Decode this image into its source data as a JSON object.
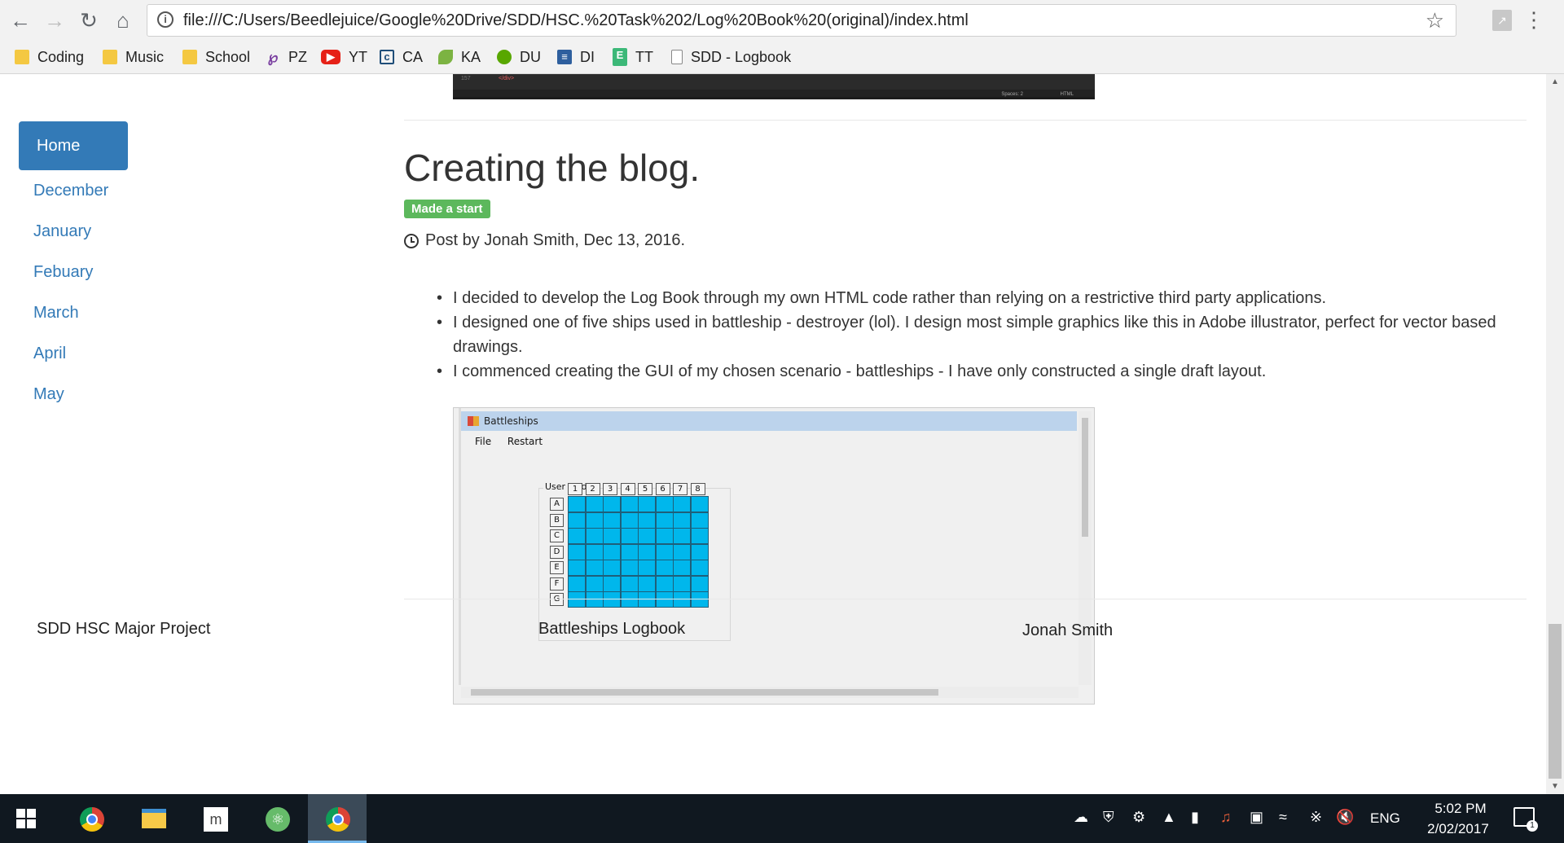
{
  "browser": {
    "url": "file:///C:/Users/Beedlejuice/Google%20Drive/SDD/HSC.%20Task%202/Log%20Book%20(original)/index.html",
    "bookmarks": [
      {
        "label": "Coding",
        "icon": "folder-icon"
      },
      {
        "label": "Music",
        "icon": "folder-icon"
      },
      {
        "label": "School",
        "icon": "folder-icon"
      },
      {
        "label": "PZ",
        "icon": "pz-icon"
      },
      {
        "label": "YT",
        "icon": "youtube-icon"
      },
      {
        "label": "CA",
        "icon": "ca-icon"
      },
      {
        "label": "KA",
        "icon": "khan-academy-icon"
      },
      {
        "label": "DU",
        "icon": "duolingo-icon"
      },
      {
        "label": "DI",
        "icon": "di-icon"
      },
      {
        "label": "TT",
        "icon": "tt-icon"
      },
      {
        "label": "SDD - Logbook",
        "icon": "page-icon"
      }
    ]
  },
  "sidebar": {
    "home": "Home",
    "items": [
      "December",
      "January",
      "Febuary",
      "March",
      "April",
      "May"
    ]
  },
  "post": {
    "title": "Creating the blog.",
    "badge": "Made a start",
    "meta": "Post by Jonah Smith, Dec 13, 2016.",
    "bullets": [
      "I decided to develop the Log Book through my own HTML code rather than relying on a restrictive third party applications.",
      "I designed one of five ships used in battleship - destroyer (lol). I design most simple graphics like this in Adobe illustrator, perfect for vector based drawings.",
      "I commenced creating the GUI of my chosen scenario - battleships - I have only constructed a single draft layout."
    ]
  },
  "prev_screenshot": {
    "line": "157",
    "tag": "</div>",
    "status_spaces": "Spaces: 2",
    "status_mode": "HTML"
  },
  "app_screenshot": {
    "title": "Battleships",
    "menu": [
      "File",
      "Restart"
    ],
    "group_label": "User Grid",
    "columns": [
      "1",
      "2",
      "3",
      "4",
      "5",
      "6",
      "7",
      "8"
    ],
    "rows": [
      "A",
      "B",
      "C",
      "D",
      "E",
      "F",
      "G"
    ],
    "cell_color": "#00b7ec"
  },
  "footer": {
    "left": "SDD HSC Major Project",
    "center": "Battleships Logbook",
    "right": "Jonah Smith"
  },
  "taskbar": {
    "time": "5:02 PM",
    "date": "2/02/2017",
    "language": "ENG",
    "notifications": "1"
  },
  "colors": {
    "accent": "#337ab7",
    "badge": "#5cb85c",
    "taskbar": "#101820"
  }
}
